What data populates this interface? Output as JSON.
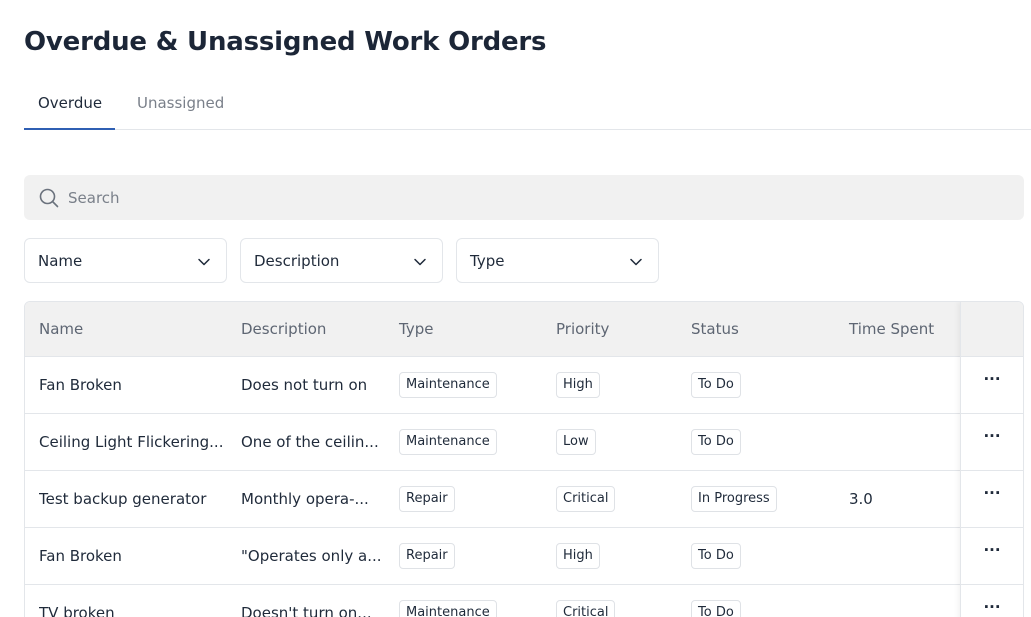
{
  "page": {
    "title": "Overdue & Unassigned Work Orders"
  },
  "tabs": [
    {
      "label": "Overdue",
      "active": true
    },
    {
      "label": "Unassigned",
      "active": false
    }
  ],
  "search": {
    "placeholder": "Search",
    "value": ""
  },
  "filters": [
    {
      "label": "Name"
    },
    {
      "label": "Description"
    },
    {
      "label": "Type"
    }
  ],
  "table": {
    "columns": [
      "Name",
      "Description",
      "Type",
      "Priority",
      "Status",
      "Time Spent"
    ],
    "rows": [
      {
        "name": "Fan Broken",
        "description": "Does not turn on",
        "type": "Maintenance",
        "priority": "High",
        "status": "To Do",
        "time_spent": ""
      },
      {
        "name": "Ceiling Light Flickering...",
        "description": "One of the ceilin...",
        "type": "Maintenance",
        "priority": "Low",
        "status": "To Do",
        "time_spent": ""
      },
      {
        "name": "Test backup generator",
        "description": "Monthly opera-...",
        "type": "Repair",
        "priority": "Critical",
        "status": "In Progress",
        "time_spent": "3.0"
      },
      {
        "name": "Fan Broken",
        "description": "\"Operates only a...",
        "type": "Repair",
        "priority": "High",
        "status": "To Do",
        "time_spent": ""
      },
      {
        "name": "TV broken",
        "description": "Doesn't turn on...",
        "type": "Maintenance",
        "priority": "Critical",
        "status": "To Do",
        "time_spent": ""
      }
    ],
    "row_action_label": "···"
  },
  "colors": {
    "accent": "#2f5fb3",
    "header_bg": "#f1f1f1",
    "border": "#e3e6ea"
  }
}
